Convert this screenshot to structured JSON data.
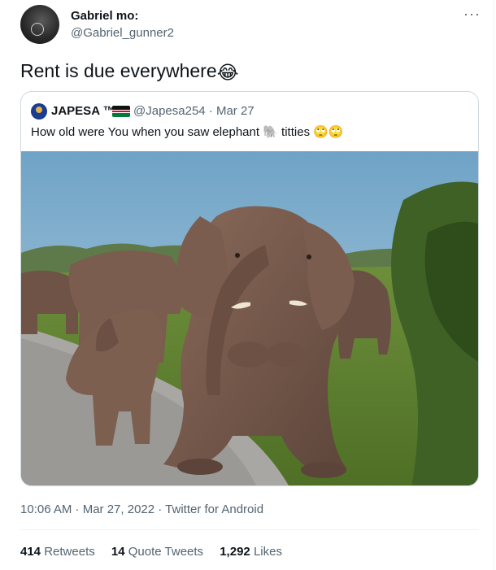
{
  "tweet": {
    "author_name": "Gabriel mo:",
    "author_handle": "@Gabriel_gunner2",
    "more_label": "···",
    "text": "Rent is due everywhere",
    "text_emoji": "😂",
    "timestamp": "10:06 AM · Mar 27, 2022",
    "source": "Twitter for Android",
    "stats": {
      "retweets_count": "414",
      "retweets_label": "Retweets",
      "quote_count": "14",
      "quote_label": "Quote Tweets",
      "likes_count": "1,292",
      "likes_label": "Likes"
    }
  },
  "quoted": {
    "author_name": "JAPESA ™",
    "author_handle": "@Japesa254",
    "date": "Mar 27",
    "text_before": "How old were You when you saw elephant ",
    "text_emoji_elephant": "🐘",
    "text_after": " titties ",
    "text_emojis_end": "🙄🙄"
  }
}
